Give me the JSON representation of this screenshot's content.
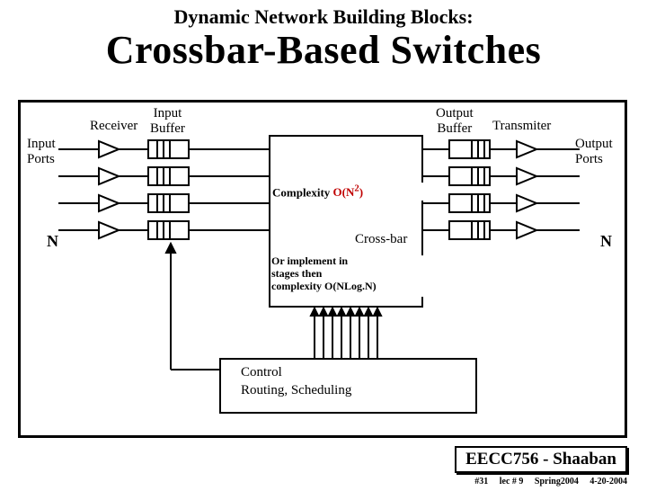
{
  "title_small": "Dynamic Network Building Blocks:",
  "title_large": "Crossbar-Based Switches",
  "labels": {
    "input_ports": "Input\nPorts",
    "receiver": "Receiver",
    "input_buffer": "Input\nBuffer",
    "output_buffer": "Output\nBuffer",
    "transmitter": "Transmiter",
    "output_ports": "Output\nPorts",
    "crossbar": "Cross-bar",
    "control": "Control",
    "routing": "Routing, Scheduling"
  },
  "complexity": {
    "prefix": "Complexity ",
    "main": "O(N",
    "exp": "2",
    "suffix": ")"
  },
  "implement": "Or implement in\nstages then\ncomplexity O(NLog.N)",
  "n_left": "N",
  "n_right": "N",
  "footer": {
    "course": "EECC756 - Shaaban",
    "slide": "#31",
    "lec": "lec # 9",
    "term": "Spring2004",
    "date": "4-20-2004"
  }
}
